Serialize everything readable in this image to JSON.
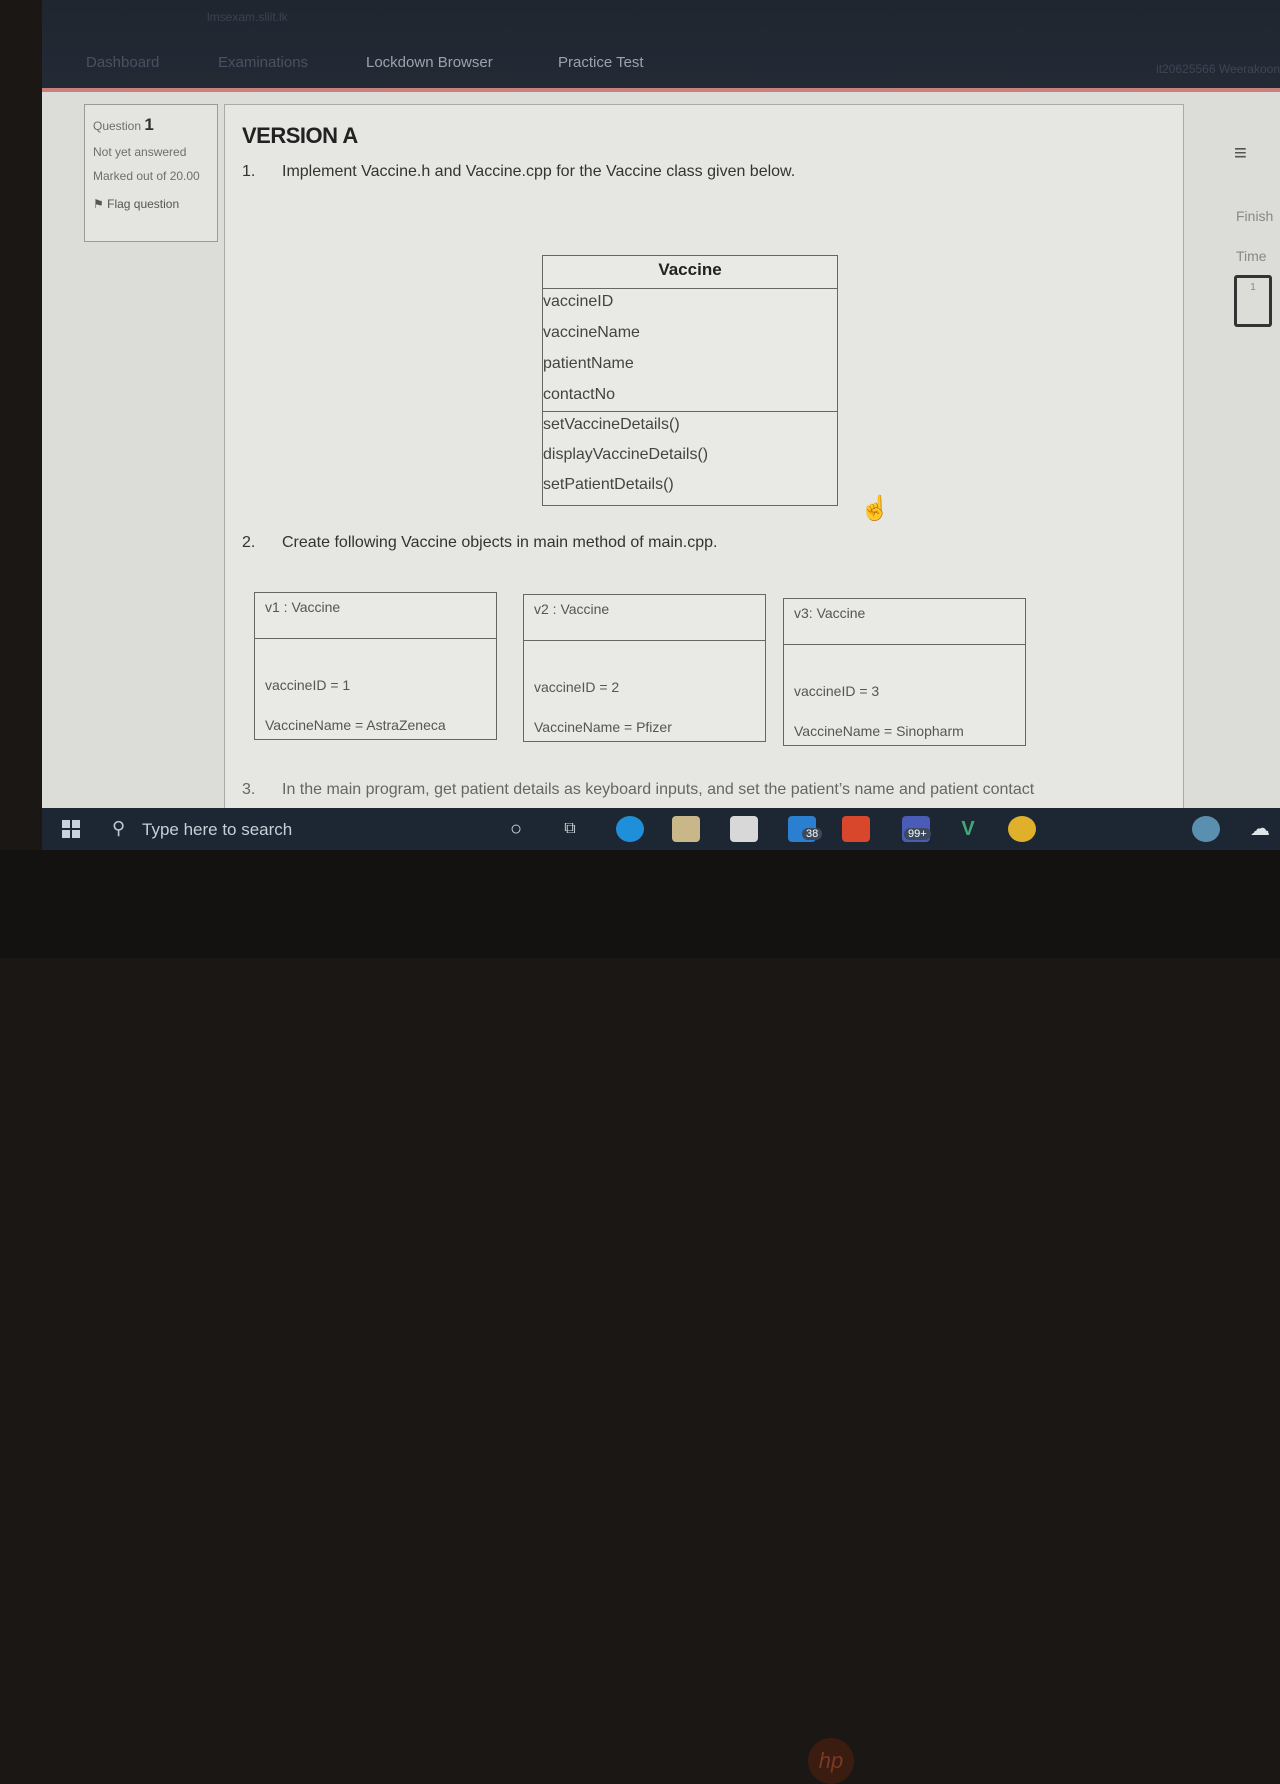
{
  "topbar": {
    "brand": "lmsexam.sliit.lk",
    "nav": [
      "Dashboard",
      "Examinations",
      "Lockdown Browser",
      "Practice Test"
    ],
    "user": "it20625566 Weerakoon"
  },
  "question_info": {
    "label": "Question",
    "number": "1",
    "status": "Not yet answered",
    "marked_out_of": "Marked out of 20.00",
    "flag": "Flag question"
  },
  "question": {
    "version": "VERSION A",
    "items": [
      {
        "num": "1.",
        "text": "Implement Vaccine.h and Vaccine.cpp for the Vaccine class given below."
      },
      {
        "num": "2.",
        "text": "Create following Vaccine objects in main method of main.cpp."
      },
      {
        "num": "3.",
        "text": "In the main program, get patient details as keyboard inputs, and set the patient’s name and patient contact"
      }
    ]
  },
  "uml_class": {
    "name": "Vaccine",
    "attributes": [
      "vaccineID",
      "vaccineName",
      "patientName",
      "contactNo"
    ],
    "operations": [
      "setVaccineDetails()",
      "displayVaccineDetails()",
      "setPatientDetails()"
    ]
  },
  "objects": [
    {
      "title": "v1 : Vaccine",
      "id": "vaccineID = 1",
      "name": "VaccineName = AstraZeneca"
    },
    {
      "title": "v2 : Vaccine",
      "id": "vaccineID = 2",
      "name": "VaccineName = Pfizer"
    },
    {
      "title": "v3: Vaccine",
      "id": "vaccineID = 3",
      "name": "VaccineName = Sinopharm"
    }
  ],
  "sidebar": {
    "menu_icon": "hamburger-icon",
    "finish": "Finish",
    "time": "Time",
    "nav_number": "1"
  },
  "taskbar": {
    "search_placeholder": "Type here to search",
    "mail_badge": "38",
    "teams_badge": "99+"
  },
  "bezel": {
    "logo": "hp"
  }
}
